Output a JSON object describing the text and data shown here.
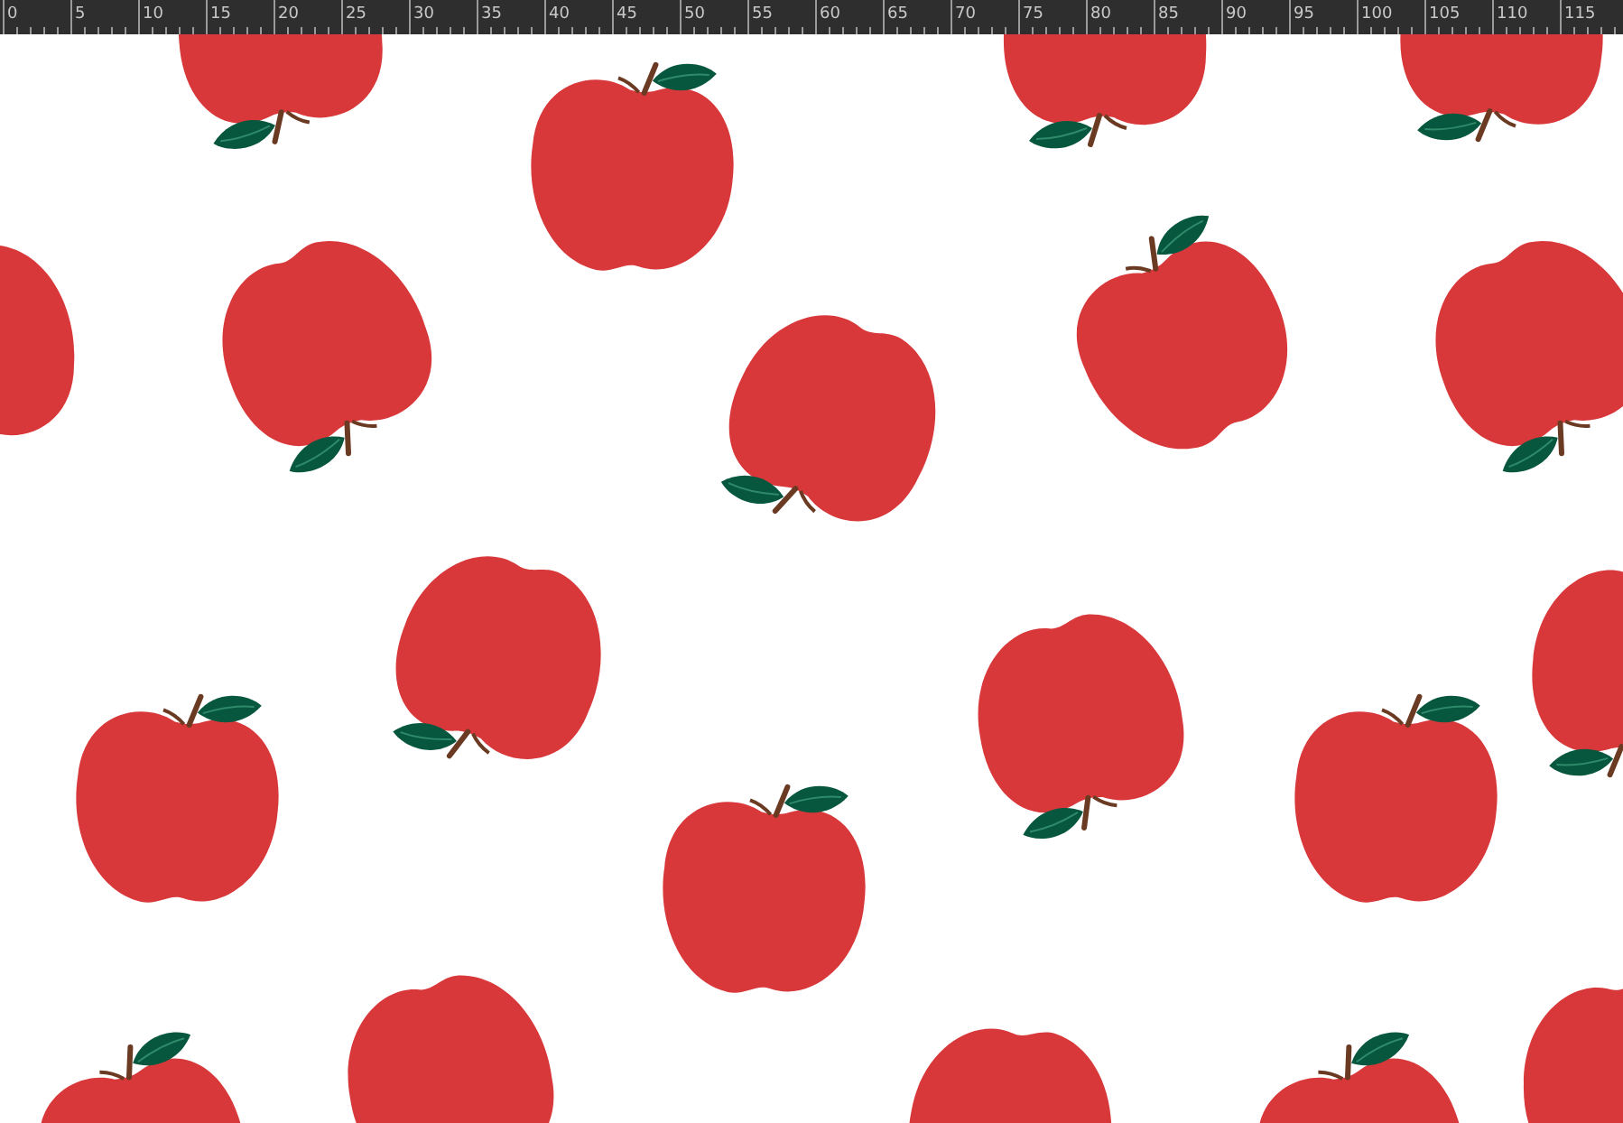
{
  "ruler": {
    "labels": [
      "0",
      "5",
      "10",
      "15",
      "20",
      "25",
      "30",
      "35",
      "40",
      "45",
      "50",
      "55",
      "60",
      "65",
      "70",
      "75",
      "80",
      "85",
      "90",
      "95",
      "100",
      "105",
      "110",
      "115"
    ]
  }
}
